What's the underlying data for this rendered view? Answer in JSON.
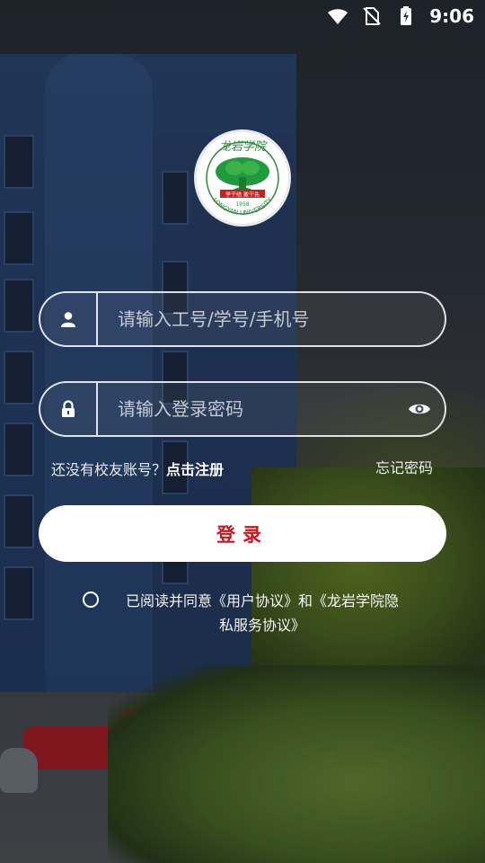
{
  "status_bar": {
    "time": "9:06",
    "icons": [
      "wifi-icon",
      "no-sim-icon",
      "battery-charging-icon"
    ]
  },
  "logo": {
    "name": "龙岩学院",
    "english": "LONGYAN UNIVERSITY",
    "motto": "学干结 敢干先",
    "year": "1958"
  },
  "form": {
    "username_placeholder": "请输入工号/学号/手机号",
    "password_placeholder": "请输入登录密码",
    "user_icon": "user-icon",
    "lock_icon": "lock-icon",
    "eye_icon": "eye-icon"
  },
  "links": {
    "no_account": "还没有校友账号？",
    "register": "点击注册",
    "forgot_password": "忘记密码"
  },
  "login_button": "登录",
  "agreement": {
    "prefix": "已阅读并同意",
    "user_agreement": "《用户协议》",
    "and": "和",
    "privacy_line1": "《龙岩学院隐",
    "privacy_line2": "私服务协议》"
  },
  "colors": {
    "accent": "#d0141c",
    "button_bg": "#ffffff",
    "field_border": "#ffffff"
  }
}
